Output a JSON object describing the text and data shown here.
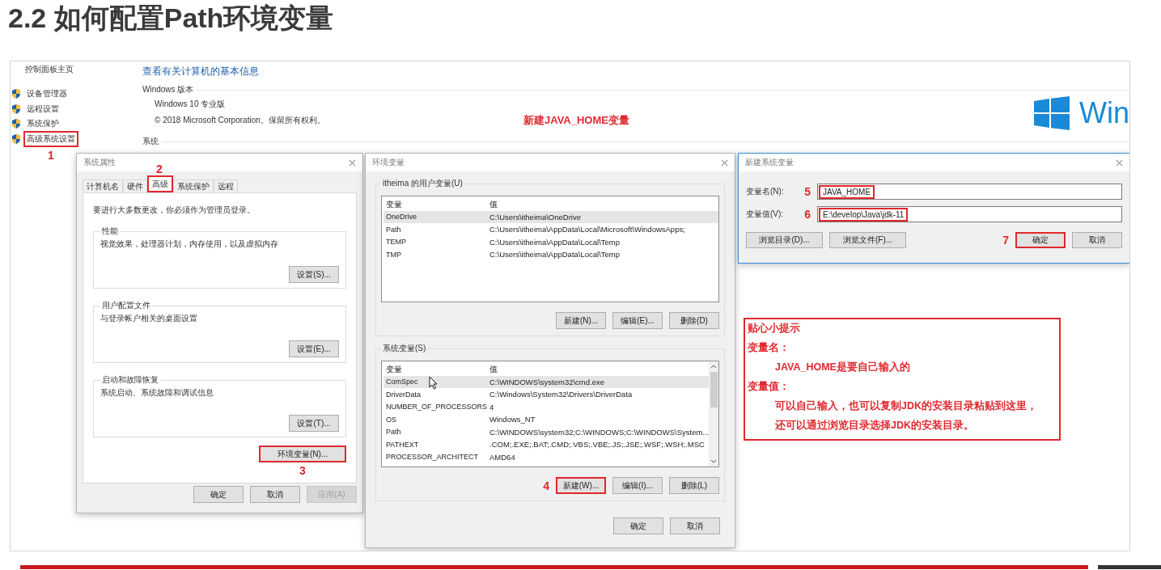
{
  "slide_title": "2.2 如何配置Path环境变量",
  "control_panel": {
    "home_link": "控制面板主页",
    "sidebar_items": [
      {
        "label": "设备管理器",
        "highlighted": false
      },
      {
        "label": "远程设置",
        "highlighted": false
      },
      {
        "label": "系统保护",
        "highlighted": false
      },
      {
        "label": "高级系统设置",
        "highlighted": true,
        "step": "1"
      }
    ],
    "heading": "查看有关计算机的基本信息",
    "edition_section": "Windows 版本",
    "edition": "Windows 10 专业版",
    "copyright": "© 2018 Microsoft Corporation。保留所有权利。",
    "system_section": "系统",
    "logo_text": "Win"
  },
  "callout": "新建JAVA_HOME变量",
  "system_properties": {
    "title": "系统属性",
    "active": false,
    "tabs": [
      {
        "label": "计算机名",
        "selected": false,
        "highlighted": false
      },
      {
        "label": "硬件",
        "selected": false,
        "highlighted": false
      },
      {
        "label": "高级",
        "selected": true,
        "highlighted": true,
        "step": "2"
      },
      {
        "label": "系统保护",
        "selected": false,
        "highlighted": false
      },
      {
        "label": "远程",
        "selected": false,
        "highlighted": false
      }
    ],
    "notice": "要进行大多数更改，你必须作为管理员登录。",
    "groups": [
      {
        "title": "性能",
        "description": "视觉效果，处理器计划，内存使用，以及虚拟内存",
        "button": "设置(S)..."
      },
      {
        "title": "用户配置文件",
        "description": "与登录帐户相关的桌面设置",
        "button": "设置(E)..."
      },
      {
        "title": "启动和故障恢复",
        "description": "系统启动、系统故障和调试信息",
        "button": "设置(T)..."
      }
    ],
    "env_button": {
      "label": "环境变量(N)...",
      "highlighted": true,
      "step": "3"
    },
    "buttons": [
      {
        "label": "确定",
        "disabled": false
      },
      {
        "label": "取消",
        "disabled": false
      },
      {
        "label": "应用(A)",
        "disabled": true
      }
    ]
  },
  "environment_variables": {
    "title": "环境变量",
    "active": false,
    "sections": [
      {
        "title": "itheima 的用户变量(U)",
        "columns": [
          "变量",
          "值"
        ],
        "scrollable": false,
        "rows": [
          {
            "name": "OneDrive",
            "value": "C:\\Users\\itheima\\OneDrive",
            "selected": true,
            "pointer": false
          },
          {
            "name": "Path",
            "value": "C:\\Users\\itheima\\AppData\\Local\\Microsoft\\WindowsApps;",
            "selected": false,
            "pointer": false
          },
          {
            "name": "TEMP",
            "value": "C:\\Users\\itheima\\AppData\\Local\\Temp",
            "selected": false,
            "pointer": false
          },
          {
            "name": "TMP",
            "value": "C:\\Users\\itheima\\AppData\\Local\\Temp",
            "selected": false,
            "pointer": false
          }
        ],
        "buttons": [
          {
            "label": "新建(N)...",
            "highlighted": false
          },
          {
            "label": "编辑(E)...",
            "highlighted": false
          },
          {
            "label": "删除(D)",
            "highlighted": false
          }
        ]
      },
      {
        "title": "系统变量(S)",
        "columns": [
          "变量",
          "值"
        ],
        "scrollable": true,
        "rows": [
          {
            "name": "ComSpec",
            "value": "C:\\WINDOWS\\system32\\cmd.exe",
            "selected": true,
            "pointer": true
          },
          {
            "name": "DriverData",
            "value": "C:\\Windows\\System32\\Drivers\\DriverData",
            "selected": false,
            "pointer": false
          },
          {
            "name": "NUMBER_OF_PROCESSORS",
            "value": "4",
            "selected": false,
            "pointer": false
          },
          {
            "name": "OS",
            "value": "Windows_NT",
            "selected": false,
            "pointer": false
          },
          {
            "name": "Path",
            "value": "C:\\WINDOWS\\system32;C:\\WINDOWS;C:\\WINDOWS\\System...",
            "selected": false,
            "pointer": false
          },
          {
            "name": "PATHEXT",
            "value": ".COM;.EXE;.BAT;.CMD;.VBS;.VBE;.JS;.JSE;.WSF;.WSH;.MSC",
            "selected": false,
            "pointer": false
          },
          {
            "name": "PROCESSOR_ARCHITECT",
            "value": "AMD64",
            "selected": false,
            "pointer": false
          }
        ],
        "buttons": [
          {
            "label": "新建(W)...",
            "highlighted": true,
            "step": "4"
          },
          {
            "label": "编辑(I)...",
            "highlighted": false
          },
          {
            "label": "删除(L)",
            "highlighted": false
          }
        ]
      }
    ],
    "buttons": [
      {
        "label": "确定"
      },
      {
        "label": "取消"
      }
    ]
  },
  "new_variable": {
    "title": "新建系统变量",
    "active": true,
    "fields": [
      {
        "label": "变量名(N):",
        "value": "JAVA_HOME",
        "highlighted": true,
        "step": "5"
      },
      {
        "label": "变量值(V):",
        "value": "E:\\develop\\Java\\jdk-11",
        "highlighted": true,
        "step": "6"
      }
    ],
    "buttons": [
      {
        "label": "浏览目录(D)...",
        "highlighted": false
      },
      {
        "label": "浏览文件(F)...",
        "highlighted": false
      },
      {
        "label": "确定",
        "highlighted": true,
        "step": "7"
      },
      {
        "label": "取消",
        "highlighted": false
      }
    ]
  },
  "tip": {
    "title": "贴心小提示",
    "lines": [
      {
        "kind": "heading",
        "text": "变量名："
      },
      {
        "kind": "detail",
        "text": "JAVA_HOME是要自己输入的"
      },
      {
        "kind": "heading",
        "text": "变量值："
      },
      {
        "kind": "detail",
        "text": "可以自己输入，也可以复制JDK的安装目录粘贴到这里，"
      },
      {
        "kind": "detail",
        "text": "还可以通过浏览目录选择JDK的安装目录。"
      }
    ]
  }
}
